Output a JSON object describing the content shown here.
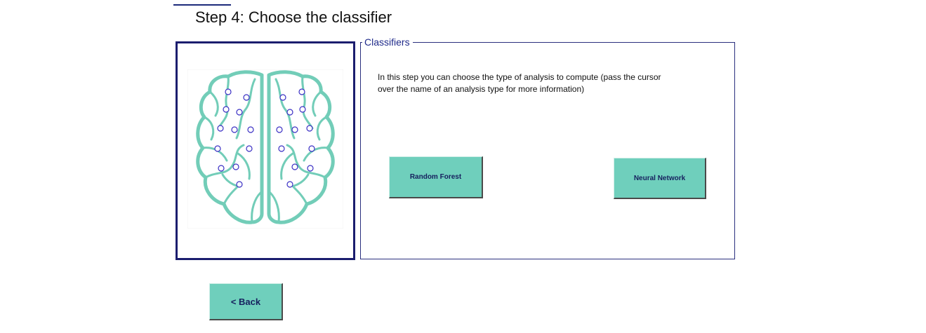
{
  "header": {
    "title": "Step 4: Choose the classifier"
  },
  "image_panel": {
    "icon": "brain-network-icon",
    "colors": {
      "frame": "#1b1d6e",
      "brain_outline": "#72cdb8",
      "node_stroke": "#3a2fc4"
    }
  },
  "classifiers": {
    "legend": "Classifiers",
    "description": "In this step you can choose the type of analysis to compute (pass the cursor over the name of an analysis type for more information)",
    "buttons": {
      "random_forest": "Random Forest",
      "neural_network": "Neural Network"
    }
  },
  "navigation": {
    "back_label": "<  Back"
  },
  "colors": {
    "button_bg": "#6fcfbc",
    "button_text": "#16205e",
    "accent": "#1f2a8a"
  }
}
